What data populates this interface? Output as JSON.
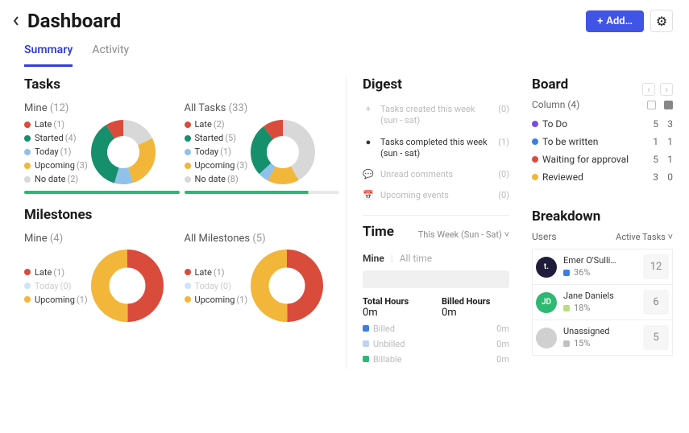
{
  "header": {
    "title": "Dashboard",
    "add_label": "Add…"
  },
  "tabs": {
    "summary": "Summary",
    "activity": "Activity"
  },
  "tasks": {
    "heading": "Tasks",
    "mine_label": "Mine",
    "mine_count": "(12)",
    "all_label": "All Tasks",
    "all_count": "(33)",
    "legend": {
      "late": "Late",
      "started": "Started",
      "today": "Today",
      "upcoming": "Upcoming",
      "nodate": "No date"
    },
    "mine": {
      "late": "(1)",
      "started": "(4)",
      "today": "(1)",
      "upcoming": "(3)",
      "nodate": "(2)"
    },
    "all": {
      "late": "(2)",
      "started": "(5)",
      "today": "(1)",
      "upcoming": "(3)",
      "nodate": "(8)"
    }
  },
  "milestones": {
    "heading": "Milestones",
    "mine_label": "Mine",
    "mine_count": "(4)",
    "all_label": "All Milestones",
    "all_count": "(5)",
    "legend": {
      "late": "Late",
      "today": "Today",
      "upcoming": "Upcoming"
    },
    "mine": {
      "late": "(1)",
      "today": "(0)",
      "upcoming": "(1)"
    },
    "all": {
      "late": "(1)",
      "today": "(0)",
      "upcoming": "(1)"
    }
  },
  "digest": {
    "heading": "Digest",
    "items": [
      {
        "icon": "+",
        "text": "Tasks created this week (sun - sat)",
        "count": "(0)",
        "active": false
      },
      {
        "icon": "✓",
        "text": "Tasks completed this week (sun - sat)",
        "count": "(1)",
        "active": true
      },
      {
        "icon": "💬",
        "text": "Unread comments",
        "count": "(0)",
        "active": false
      },
      {
        "icon": "📅",
        "text": "Upcoming events",
        "count": "(0)",
        "active": false
      }
    ]
  },
  "time": {
    "heading": "Time",
    "selector": "This Week (Sun - Sat)",
    "tab_mine": "Mine",
    "tab_all": "All time",
    "total_label": "Total Hours",
    "total_val": "0m",
    "billed_label": "Billed Hours",
    "billed_val": "0m",
    "rows": [
      {
        "color": "#3b7fe0",
        "label": "Billed",
        "val": "0m"
      },
      {
        "color": "#b9d4f4",
        "label": "Unbilled",
        "val": "0m"
      },
      {
        "color": "#2eb872",
        "label": "Billable",
        "val": "0m"
      }
    ]
  },
  "board": {
    "heading": "Board",
    "column_label": "Column",
    "column_count": "(4)",
    "rows": [
      {
        "color": "#7a4de0",
        "name": "To Do",
        "a": "5",
        "b": "3"
      },
      {
        "color": "#3b7fe0",
        "name": "To be written",
        "a": "1",
        "b": "1"
      },
      {
        "color": "#d94b3b",
        "name": "Waiting for approval",
        "a": "5",
        "b": "1"
      },
      {
        "color": "#f2b63a",
        "name": "Reviewed",
        "a": "3",
        "b": "0"
      }
    ]
  },
  "breakdown": {
    "heading": "Breakdown",
    "users_label": "Users",
    "filter": "Active Tasks",
    "users": [
      {
        "avatar_bg": "#1f1b3a",
        "avatar_txt": "t.",
        "name": "Emer O'Sulli…",
        "pct": "36%",
        "bar": "#3b7fe0",
        "count": "12"
      },
      {
        "avatar_bg": "#2eb872",
        "avatar_txt": "JD",
        "name": "Jane Daniels",
        "pct": "18%",
        "bar": "#b7e07a",
        "count": "6"
      },
      {
        "avatar_bg": "#d0d0d0",
        "avatar_txt": "",
        "name": "Unassigned",
        "pct": "15%",
        "bar": "#c0c0c0",
        "count": "5"
      }
    ]
  },
  "chart_data": [
    {
      "type": "pie",
      "title": "Tasks – Mine (12)",
      "series": [
        {
          "name": "Late",
          "value": 1,
          "color": "#d94b3b"
        },
        {
          "name": "Started",
          "value": 4,
          "color": "#168f6d"
        },
        {
          "name": "Today",
          "value": 1,
          "color": "#8fc1ea"
        },
        {
          "name": "Upcoming",
          "value": 3,
          "color": "#f2b63a"
        },
        {
          "name": "No date",
          "value": 2,
          "color": "#d8d8d8"
        }
      ]
    },
    {
      "type": "pie",
      "title": "Tasks – All Tasks (33)",
      "series": [
        {
          "name": "Late",
          "value": 2,
          "color": "#d94b3b"
        },
        {
          "name": "Started",
          "value": 5,
          "color": "#168f6d"
        },
        {
          "name": "Today",
          "value": 1,
          "color": "#8fc1ea"
        },
        {
          "name": "Upcoming",
          "value": 3,
          "color": "#f2b63a"
        },
        {
          "name": "No date",
          "value": 8,
          "color": "#d8d8d8"
        }
      ]
    },
    {
      "type": "pie",
      "title": "Milestones – Mine (4)",
      "series": [
        {
          "name": "Late",
          "value": 1,
          "color": "#d94b3b"
        },
        {
          "name": "Today",
          "value": 0,
          "color": "#8fc1ea"
        },
        {
          "name": "Upcoming",
          "value": 1,
          "color": "#f2b63a"
        }
      ]
    },
    {
      "type": "pie",
      "title": "Milestones – All Milestones (5)",
      "series": [
        {
          "name": "Late",
          "value": 1,
          "color": "#d94b3b"
        },
        {
          "name": "Today",
          "value": 0,
          "color": "#8fc1ea"
        },
        {
          "name": "Upcoming",
          "value": 1,
          "color": "#f2b63a"
        }
      ]
    }
  ]
}
